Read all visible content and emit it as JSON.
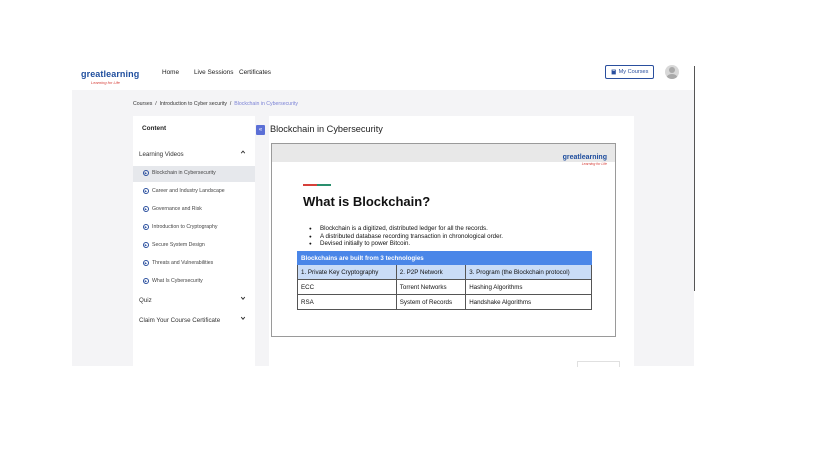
{
  "header": {
    "logo_brand": "greatlearning",
    "logo_tagline": "Learning for Life",
    "nav": [
      "Home",
      "Live Sessions",
      "Certificates"
    ],
    "my_courses": "My Courses"
  },
  "breadcrumb": {
    "items": [
      "Courses",
      "Introduction to Cyber security",
      "Blockchain in Cybersecurity"
    ],
    "separator": "/"
  },
  "sidebar": {
    "title": "Content",
    "sections": [
      {
        "label": "Learning Videos",
        "chevron": "^"
      },
      {
        "label": "Quiz",
        "chevron": "v"
      },
      {
        "label": "Claim Your Course Certificate",
        "chevron": "v"
      }
    ],
    "items": [
      "Blockchain in Cybersecurity",
      "Career and Industry Landscape",
      "Governance and Risk",
      "Introduction to Cryptography",
      "Secure System Design",
      "Threats and Vulnerabilities",
      "What Is Cybersecurity"
    ],
    "selected_index": 0,
    "collapse_icon": "«"
  },
  "content": {
    "title": "Blockchain in Cybersecurity",
    "slide": {
      "logo_brand": "greatlearning",
      "logo_tagline": "Learning for Life",
      "heading": "What is Blockchain?",
      "bullets": [
        "Blockchain is a digitized, distributed ledger for all the records.",
        "A distributed database recording transaction in chronological order.",
        "Devised initially to power Bitcoin."
      ],
      "table": {
        "header": "Blockchains are built from 3 technologies",
        "columns": [
          "1. Private Key Cryptography",
          "2. P2P Network",
          "3. Program (the Blockchain protocol)"
        ],
        "rows": [
          [
            "ECC",
            "Torrent Networks",
            "Hashing Algorithms"
          ],
          [
            "RSA",
            "System of Records",
            "Handshake Algorithms"
          ]
        ]
      }
    }
  },
  "colors": {
    "brand_blue": "#1f4e9e",
    "accent_purple": "#5b6fd6",
    "table_header": "#4a86e8",
    "table_subheader": "#c9dcf7"
  }
}
